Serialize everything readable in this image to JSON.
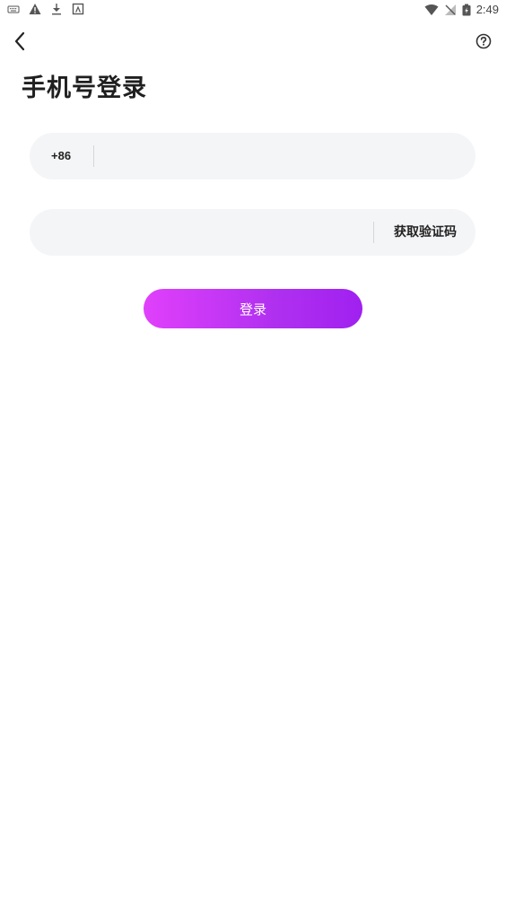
{
  "status_bar": {
    "time": "2:49",
    "left_icons": [
      "keyboard-icon",
      "warning-icon",
      "download-icon",
      "a-box-icon"
    ],
    "right_icons": [
      "wifi-icon",
      "no-sim-icon",
      "battery-icon"
    ]
  },
  "nav": {
    "back_icon": "chevron-left-icon",
    "help_icon": "help-circle-icon"
  },
  "page": {
    "title": "手机号登录"
  },
  "phone_field": {
    "country_code": "+86",
    "value": "",
    "placeholder": ""
  },
  "code_field": {
    "value": "",
    "placeholder": "",
    "get_code_label": "获取验证码"
  },
  "login_button": {
    "label": "登录"
  },
  "colors": {
    "field_background": "#f4f5f7",
    "accent_gradient_start": "#e040fb",
    "accent_gradient_end": "#a020f0",
    "title_text": "#1f1f1f"
  }
}
